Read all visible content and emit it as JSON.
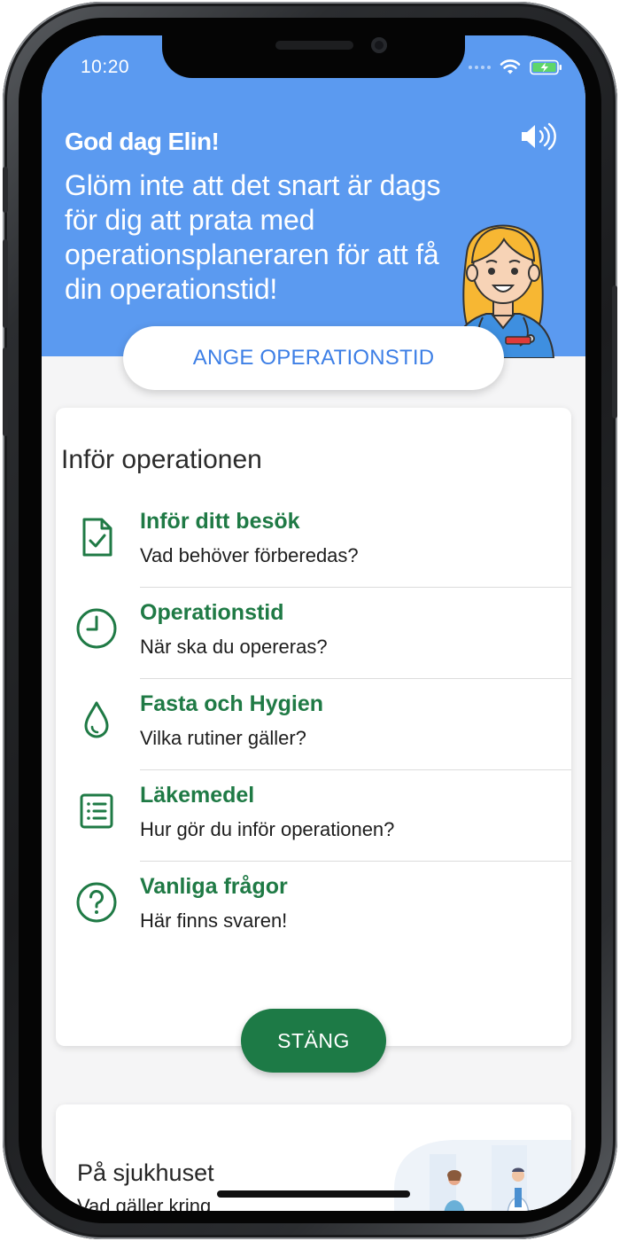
{
  "status_bar": {
    "time": "10:20",
    "icons": [
      "signal-dots-icon",
      "wifi-icon",
      "battery-charging-icon"
    ]
  },
  "header": {
    "greeting": "God dag Elin!",
    "message": "Glöm inte att det snart är dags för dig att prata med operationsplaneraren för att få din operationstid!",
    "speaker_icon": "speaker-icon",
    "background_color": "#5b9af0",
    "action_label": "ANGE OPERATIONSTID"
  },
  "card": {
    "title": "Inför operationen",
    "items": [
      {
        "icon": "document-check-icon",
        "title": "Inför ditt besök",
        "subtitle": "Vad behöver förberedas?"
      },
      {
        "icon": "clock-icon",
        "title": "Operationstid",
        "subtitle": "När ska du opereras?"
      },
      {
        "icon": "water-drop-icon",
        "title": "Fasta och Hygien",
        "subtitle": "Vilka rutiner gäller?"
      },
      {
        "icon": "list-icon",
        "title": "Läkemedel",
        "subtitle": "Hur gör du inför operationen?"
      },
      {
        "icon": "question-circle-icon",
        "title": "Vanliga frågor",
        "subtitle": "Här finns svaren!"
      }
    ],
    "close_label": "STÄNG",
    "accent_color": "#1f7a45"
  },
  "card2": {
    "title": "På sjukhuset",
    "subtitle": "Vad gäller kring"
  }
}
